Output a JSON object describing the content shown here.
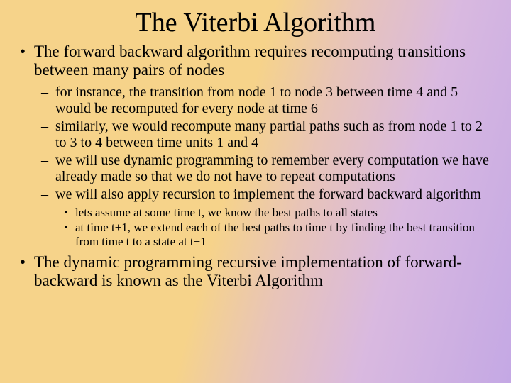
{
  "title": "The Viterbi Algorithm",
  "bullets": {
    "b1": "The forward backward algorithm requires recomputing transitions between many pairs of nodes",
    "sub": {
      "s1": "for instance, the transition from node 1 to node 3 between time 4 and 5 would be recomputed for every node at time 6",
      "s2": "similarly, we would recompute many partial paths such as from node 1 to 2 to 3 to 4 between time units 1 and 4",
      "s3": "we will use dynamic programming to remember every computation we have already made so that we do not have to repeat computations",
      "s4": "we will also apply recursion to implement the forward backward algorithm"
    },
    "subsub": {
      "t1": "lets assume at some time t, we know the best paths to all states",
      "t2": "at time t+1, we extend each of the best paths to time t by finding the best transition from time t to a state at t+1"
    },
    "b2": "The dynamic programming recursive implementation of forward-backward is known as the Viterbi Algorithm"
  }
}
